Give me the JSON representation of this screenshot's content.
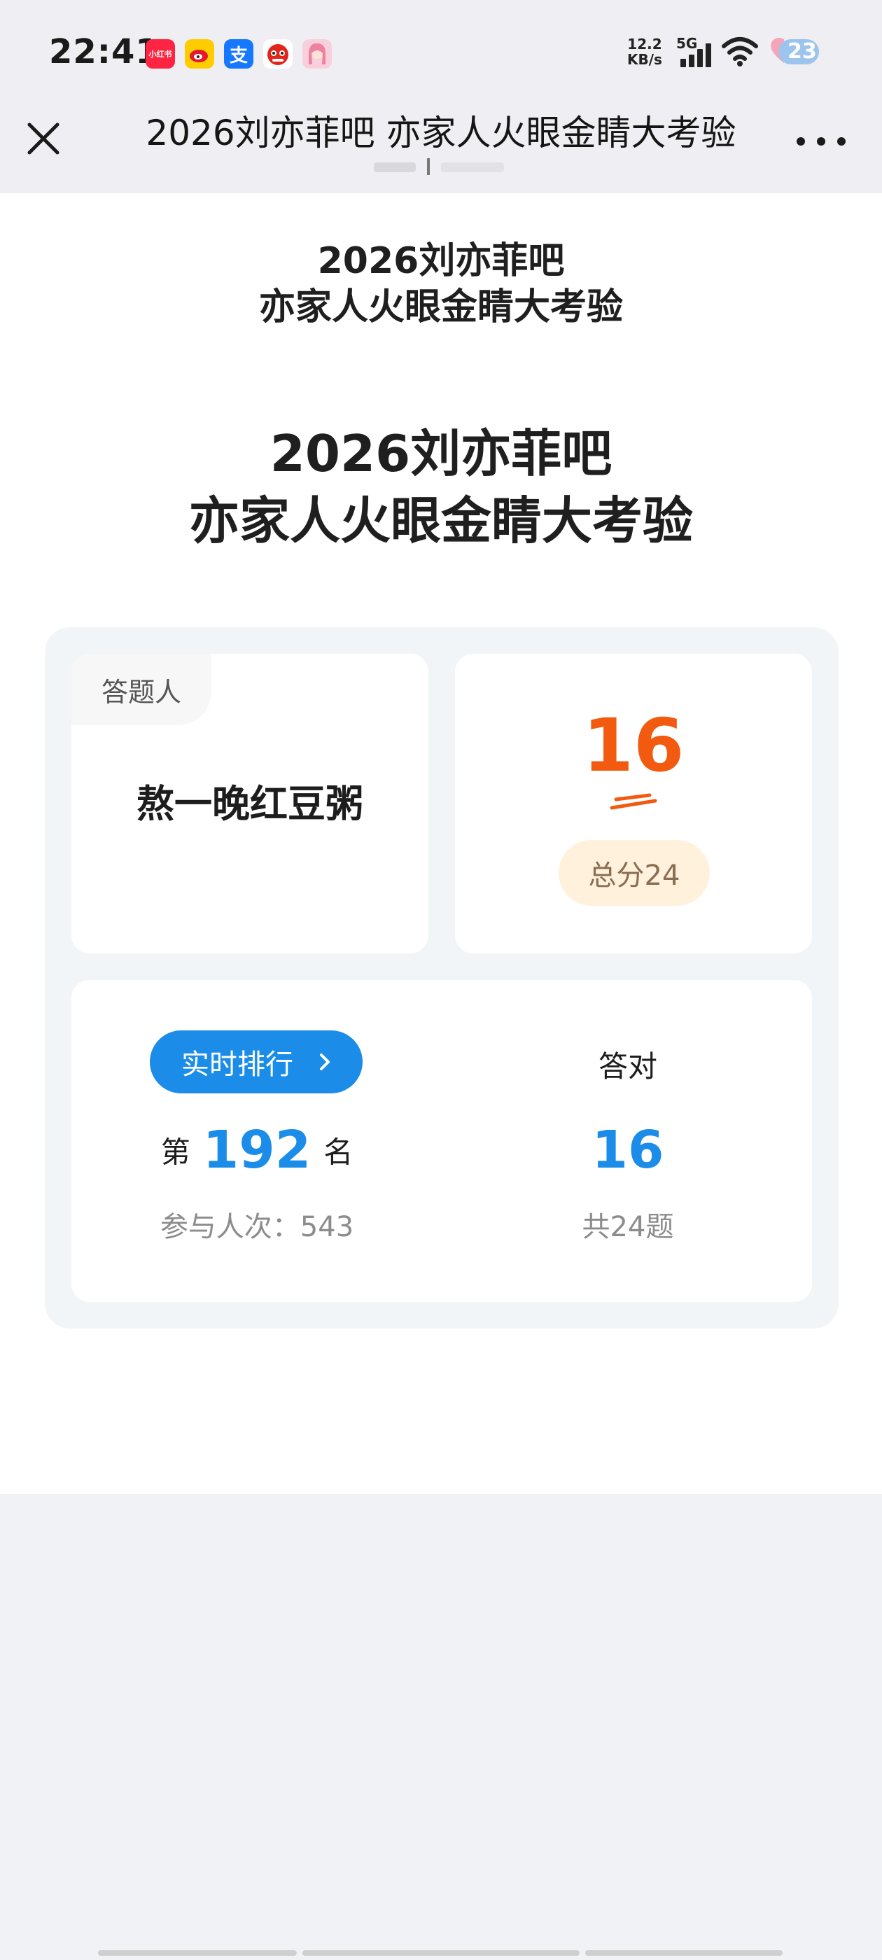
{
  "status_bar": {
    "time": "22:41",
    "net_speed_value": "12.2",
    "net_speed_unit": "KB/s",
    "network": "5G",
    "battery": "23",
    "app_icons": [
      {
        "name": "xiaohongshu-icon",
        "label": "小红书",
        "color": "#ff2442"
      },
      {
        "name": "weibo-icon",
        "label": "",
        "color": "#ffcc00"
      },
      {
        "name": "alipay-icon",
        "label": "支",
        "color": "#1677ff"
      },
      {
        "name": "jd-icon",
        "label": "",
        "color": "#e1251b"
      },
      {
        "name": "avatar-app-icon",
        "label": "",
        "color": "#f3a3b5"
      }
    ]
  },
  "nav": {
    "title": "2026刘亦菲吧 亦家人火眼金睛大考验"
  },
  "header": {
    "small_title_line1": "2026刘亦菲吧",
    "small_title_line2": "亦家人火眼金睛大考验",
    "big_title_line1": "2026刘亦菲吧",
    "big_title_line2": "亦家人火眼金睛大考验"
  },
  "result": {
    "user_tag": "答题人",
    "user_name": "熬一晚红豆粥",
    "score": "16",
    "total_score": "总分24",
    "rank_button": "实时排行",
    "rank_prefix": "第",
    "rank_number": "192",
    "rank_suffix": "名",
    "participants": "参与人次：543",
    "correct_label": "答对",
    "correct_value": "16",
    "question_total": "共24题"
  },
  "colors": {
    "accent_blue": "#1b8de8",
    "score_orange": "#f15a0f",
    "pill_bg": "#fff1dc"
  }
}
